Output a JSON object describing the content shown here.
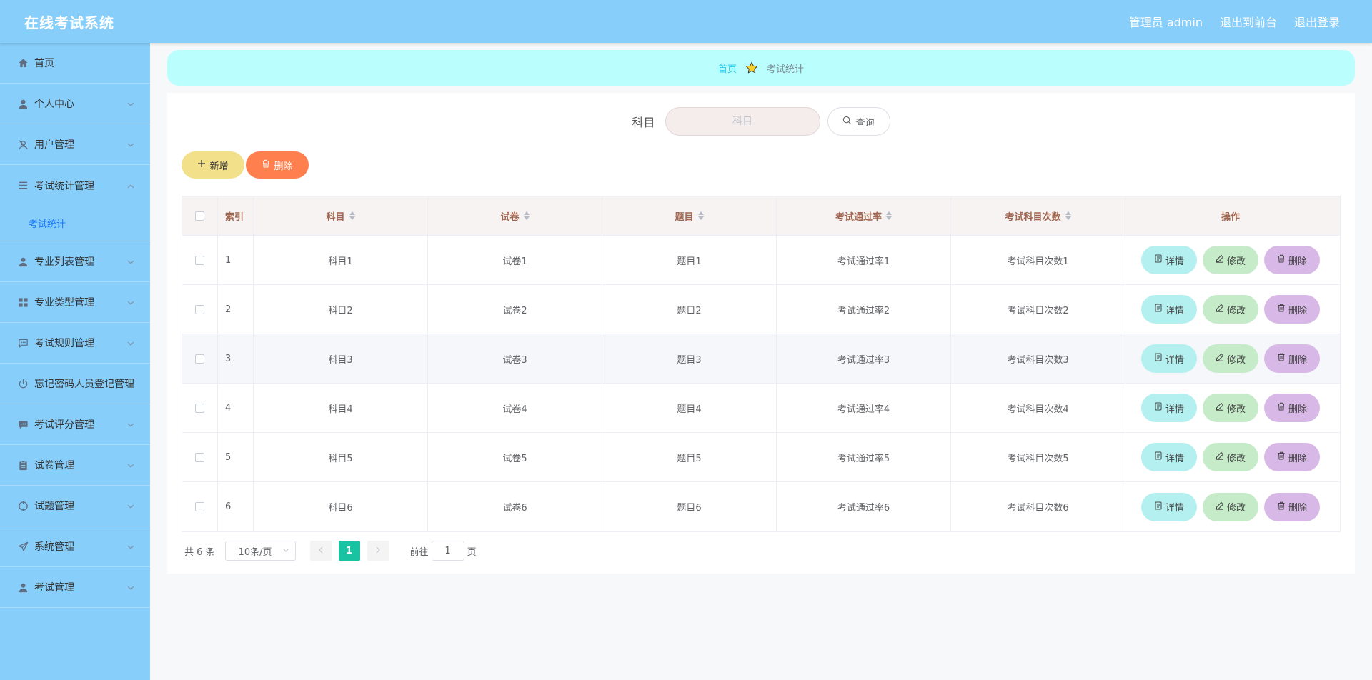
{
  "header": {
    "title": "在线考试系统",
    "role": "管理员 admin",
    "to_front": "退出到前台",
    "logout": "退出登录"
  },
  "sidebar": {
    "items": [
      {
        "label": "首页",
        "icon": "home-icon"
      },
      {
        "label": "个人中心",
        "icon": "user-icon"
      },
      {
        "label": "用户管理",
        "icon": "user-slash-icon"
      },
      {
        "label": "考试统计管理",
        "icon": "menu-icon"
      },
      {
        "label": "专业列表管理",
        "icon": "user-icon"
      },
      {
        "label": "专业类型管理",
        "icon": "grid-icon"
      },
      {
        "label": "考试规则管理",
        "icon": "chat-icon"
      },
      {
        "label": "忘记密码人员登记管理",
        "icon": "power-icon"
      },
      {
        "label": "考试评分管理",
        "icon": "message-icon"
      },
      {
        "label": "试卷管理",
        "icon": "clipboard-icon"
      },
      {
        "label": "试题管理",
        "icon": "crosshair-icon"
      },
      {
        "label": "系统管理",
        "icon": "send-icon"
      },
      {
        "label": "考试管理",
        "icon": "user-icon"
      }
    ],
    "sub_item": "考试统计"
  },
  "breadcrumb": {
    "home": "首页",
    "current": "考试统计"
  },
  "search": {
    "label": "科目",
    "placeholder": "科目",
    "button": "查询"
  },
  "toolbar": {
    "add": "新增",
    "delete": "删除"
  },
  "table": {
    "headers": {
      "index": "索引",
      "subject": "科目",
      "paper": "试卷",
      "question": "题目",
      "pass_rate": "考试通过率",
      "count": "考试科目次数",
      "ops": "操作"
    },
    "rows": [
      {
        "index": "1",
        "subject": "科目1",
        "paper": "试卷1",
        "question": "题目1",
        "pass_rate": "考试通过率1",
        "count": "考试科目次数1"
      },
      {
        "index": "2",
        "subject": "科目2",
        "paper": "试卷2",
        "question": "题目2",
        "pass_rate": "考试通过率2",
        "count": "考试科目次数2"
      },
      {
        "index": "3",
        "subject": "科目3",
        "paper": "试卷3",
        "question": "题目3",
        "pass_rate": "考试通过率3",
        "count": "考试科目次数3"
      },
      {
        "index": "4",
        "subject": "科目4",
        "paper": "试卷4",
        "question": "题目4",
        "pass_rate": "考试通过率4",
        "count": "考试科目次数4"
      },
      {
        "index": "5",
        "subject": "科目5",
        "paper": "试卷5",
        "question": "题目5",
        "pass_rate": "考试通过率5",
        "count": "考试科目次数5"
      },
      {
        "index": "6",
        "subject": "科目6",
        "paper": "试卷6",
        "question": "题目6",
        "pass_rate": "考试通过率6",
        "count": "考试科目次数6"
      }
    ],
    "ops": {
      "detail": "详情",
      "edit": "修改",
      "remove": "删除"
    }
  },
  "pagination": {
    "total": "共 6 条",
    "page_size": "10条/页",
    "current_page": "1",
    "goto_prefix": "前往",
    "goto_value": "1",
    "goto_suffix": "页"
  },
  "colors": {
    "header_bg": "#87cefa",
    "breadcrumb_bg": "#bbfefe",
    "add_btn": "#f2e08a",
    "delete_btn": "#ff7f4f",
    "detail_btn": "#b3f0ef",
    "edit_btn": "#c5ebc9",
    "remove_btn": "#d8b8e6",
    "active_page": "#19c2a0"
  }
}
